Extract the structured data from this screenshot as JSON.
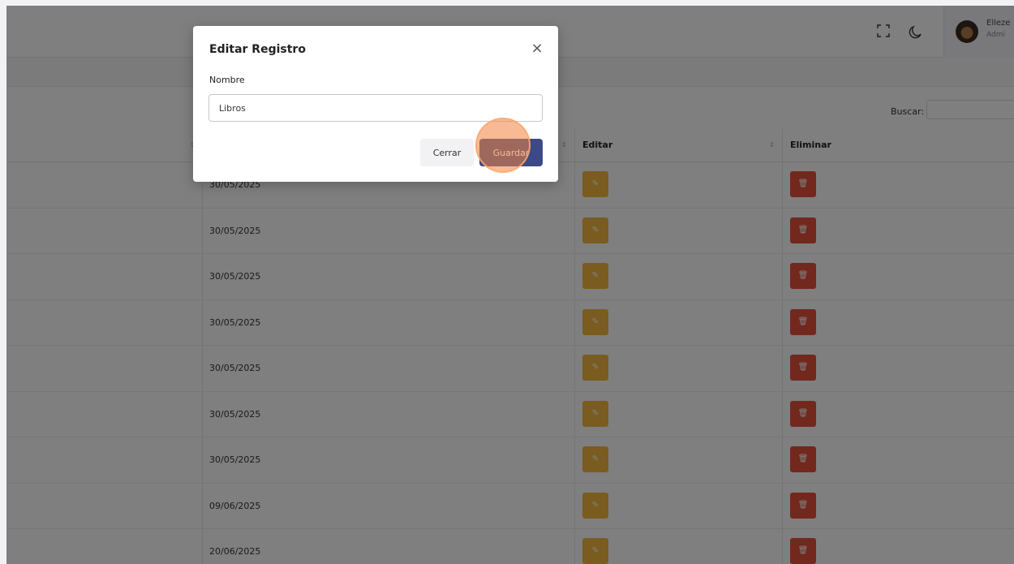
{
  "header": {
    "user_name": "Elleze",
    "user_role": "Admi"
  },
  "search": {
    "label": "Buscar:",
    "value": ""
  },
  "table": {
    "columns": [
      "Editar",
      "Eliminar"
    ],
    "rows": [
      {
        "date": "30/05/2025"
      },
      {
        "date": "30/05/2025"
      },
      {
        "date": "30/05/2025"
      },
      {
        "date": "30/05/2025"
      },
      {
        "date": "30/05/2025"
      },
      {
        "date": "30/05/2025"
      },
      {
        "date": "30/05/2025"
      },
      {
        "date": "09/06/2025"
      },
      {
        "date": "20/06/2025"
      }
    ]
  },
  "modal": {
    "title": "Editar Registro",
    "field_label": "Nombre",
    "field_value": "Libros",
    "cancel_label": "Cerrar",
    "save_label": "Guardar"
  },
  "colors": {
    "edit_button": "#f5b942",
    "delete_button": "#e4503b",
    "primary": "#3b4a86"
  }
}
